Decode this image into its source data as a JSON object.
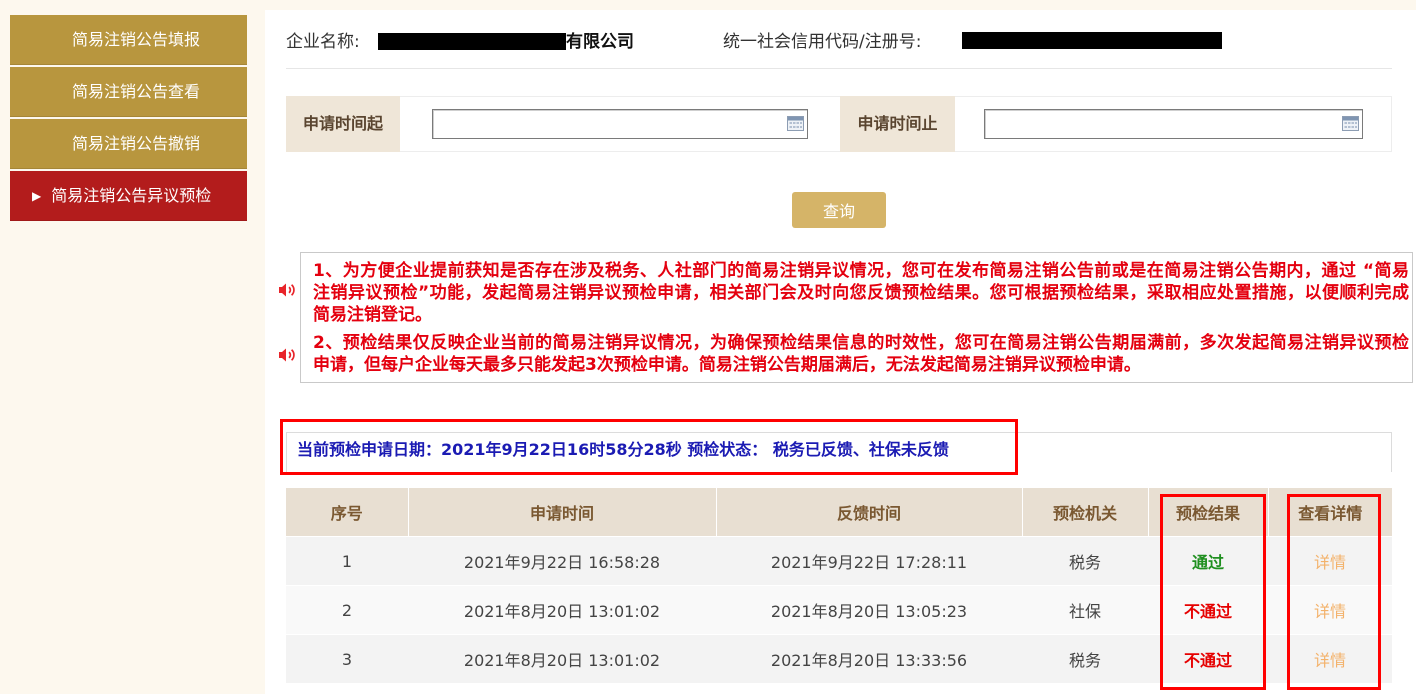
{
  "sidebar": {
    "active_marker": "▶",
    "items": [
      {
        "label": "简易注销公告填报"
      },
      {
        "label": "简易注销公告查看"
      },
      {
        "label": "简易注销公告撤销"
      },
      {
        "label": "简易注销公告异议预检"
      }
    ]
  },
  "header": {
    "company_label": "企业名称:",
    "company_suffix": "有限公司",
    "code_label": "统一社会信用代码/注册号:"
  },
  "search": {
    "start_label": "申请时间起",
    "start_value": "",
    "end_label": "申请时间止",
    "end_value": "",
    "query_button": "查询"
  },
  "notice": {
    "paragraphs": [
      {
        "lines": [
          "1、为方便企业提前获知是否存在涉及税务、人社部门的简易注销异议情况，您可在发布简易注销公告前或是在简易注销公告期内，通过 “简易",
          "注销异议预检”功能，发起简易注销异议预检申请，相关部门会及时向您反馈预检结果。您可根据预检结果，采取相应处置措施，以便顺利完成",
          "简易注销登记。"
        ]
      },
      {
        "lines": [
          "2、预检结果仅反映企业当前的简易注销异议情况，为确保预检结果信息的时效性，您可在简易注销公告期届满前，多次发起简易注销异议预检",
          "申请，但每户企业每天最多只能发起3次预检申请。简易注销公告期届满后，无法发起简易注销异议预检申请。"
        ]
      }
    ]
  },
  "status": {
    "text": "当前预检申请日期：2021年9月22日16时58分28秒 预检状态： 税务已反馈、社保未反馈"
  },
  "table": {
    "headers": [
      "序号",
      "申请时间",
      "反馈时间",
      "预检机关",
      "预检结果",
      "查看详情"
    ],
    "rows": [
      {
        "index": "1",
        "apply_time": "2021年9月22日 16:58:28",
        "feedback_time": "2021年9月22日 17:28:11",
        "authority": "税务",
        "result": "通过",
        "detail": "详情"
      },
      {
        "index": "2",
        "apply_time": "2021年8月20日 13:01:02",
        "feedback_time": "2021年8月20日 13:05:23",
        "authority": "社保",
        "result": "不通过",
        "detail": "详情"
      },
      {
        "index": "3",
        "apply_time": "2021年8月20日 13:01:02",
        "feedback_time": "2021年8月20日 13:33:56",
        "authority": "税务",
        "result": "不通过",
        "detail": "详情"
      }
    ]
  },
  "icons": {
    "notice": "speaker-icon",
    "date_picker": "calendar-icon",
    "active_item": "triangle-right-icon"
  },
  "colors": {
    "accent": "#b8963e",
    "active": "#b31c1c",
    "notice_text": "#e4000f",
    "status_text": "#1b1bb3",
    "result_pass": "#1f8f1f",
    "result_fail": "#e60000",
    "detail_link": "#f3b26b",
    "header_text": "#7a5831",
    "label_bg": "#efe6d8",
    "button": "#d5b468",
    "annotation": "#ff0000"
  }
}
